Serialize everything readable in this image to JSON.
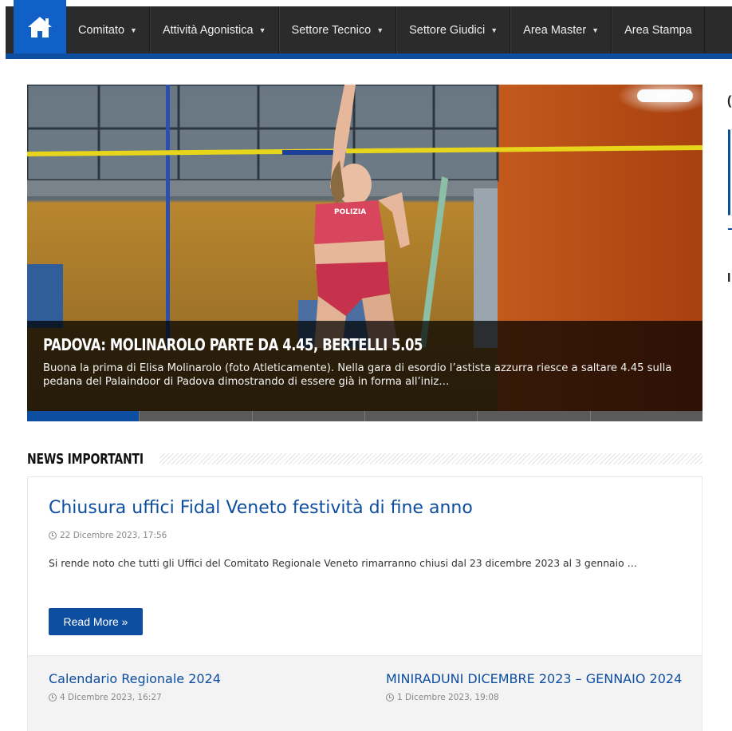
{
  "nav": {
    "home_icon": "home-icon",
    "items": [
      {
        "label": "Comitato"
      },
      {
        "label": "Attività Agonistica"
      },
      {
        "label": "Settore Tecnico"
      },
      {
        "label": "Settore Giudici"
      },
      {
        "label": "Area Master"
      },
      {
        "label": "Area Stampa"
      }
    ],
    "caret": "▼"
  },
  "slider": {
    "title": "PADOVA: MOLINAROLO PARTE DA 4.45, BERTELLI 5.05",
    "text": "Buona la prima di Elisa Molinarolo (foto Atleticamente). Nella gara di esordio l’astista azzurra riesce a saltare 4.45 sulla pedana del Palaindoor di Padova dimostrando di essere già in forma all’iniz…",
    "jersey_text": "POLIZIA",
    "active_index": 0
  },
  "section": {
    "title": "NEWS IMPORTANTI"
  },
  "featured": {
    "title": "Chiusura uffici Fidal Veneto festività di fine anno",
    "date": "22 Dicembre 2023, 17:56",
    "excerpt": "Si rende noto che tutti gli Uffici del Comitato Regionale Veneto rimarranno chiusi dal 23 dicembre 2023 al 3 gennaio …",
    "read_more": "Read More »"
  },
  "secondary": [
    {
      "title": "Calendario Regionale 2024",
      "date": "4 Dicembre 2023, 16:27"
    },
    {
      "title": "MINIRADUNI DICEMBRE 2023 – GENNAIO 2024",
      "date": "1 Dicembre 2023, 19:08"
    }
  ],
  "colors": {
    "brand_blue": "#0d4ea0",
    "nav_dark": "#2b2b2b"
  }
}
